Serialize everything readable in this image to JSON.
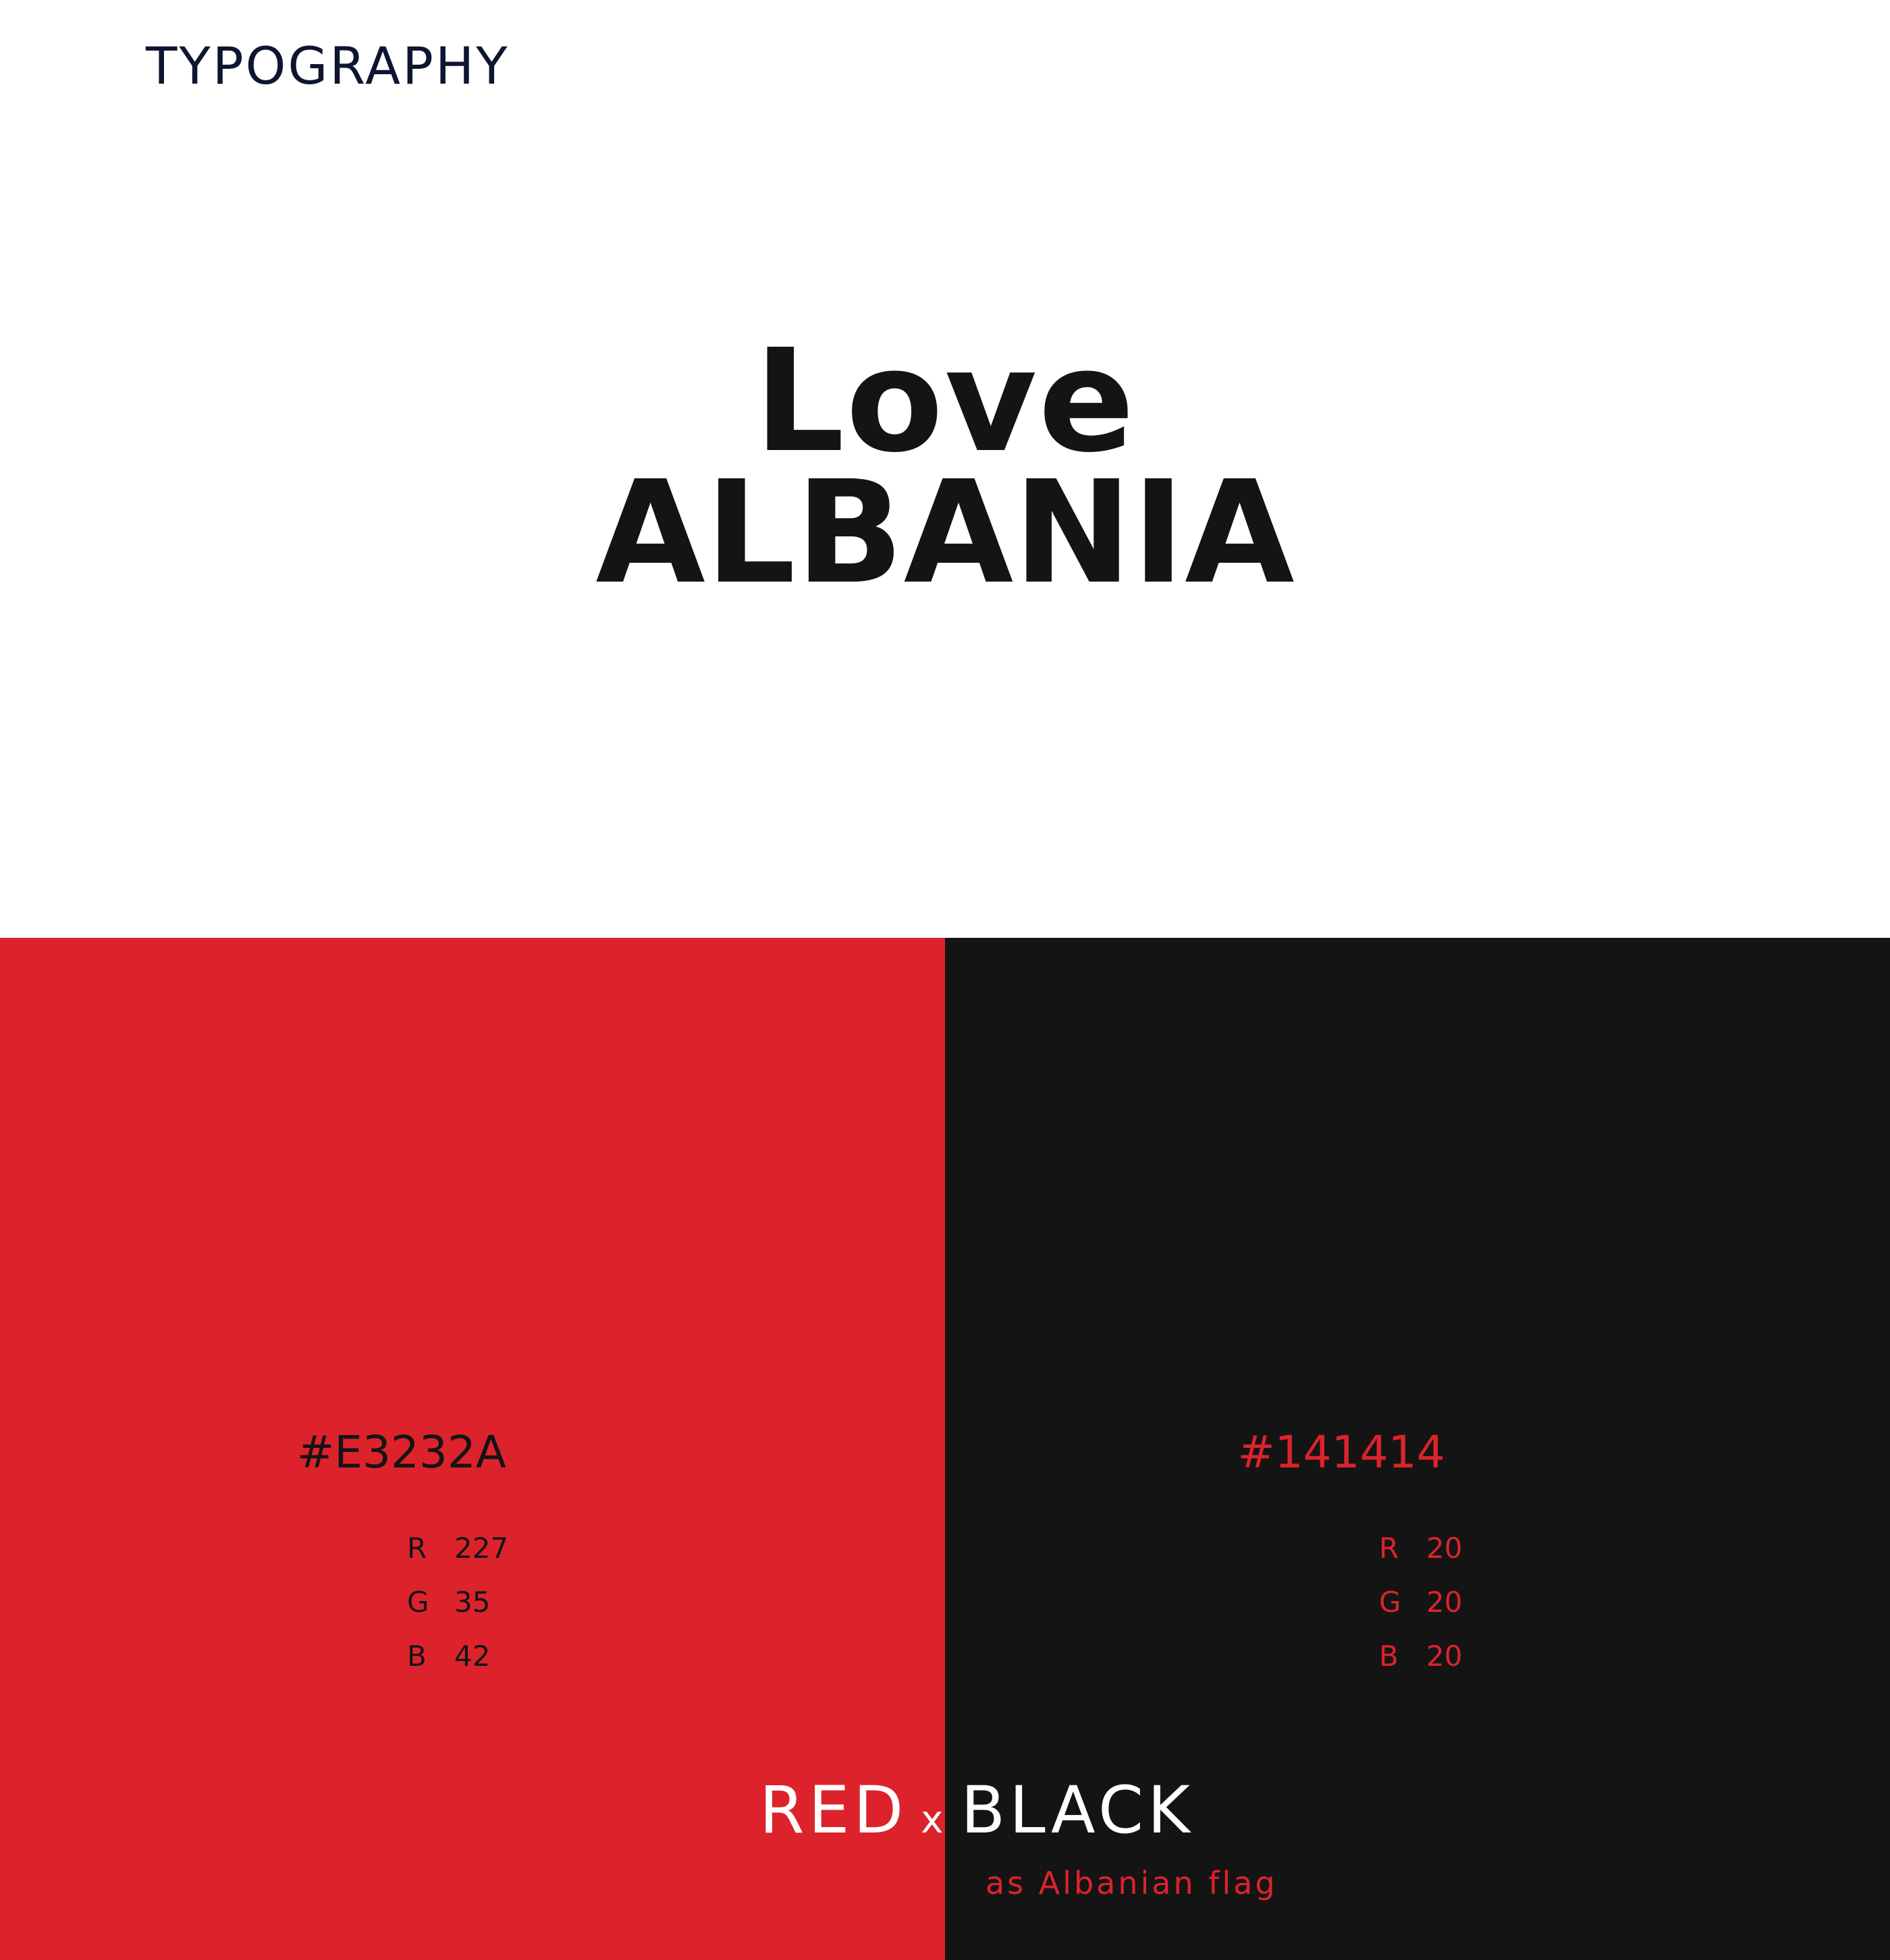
{
  "header": {
    "title": "TYPOGRAPHY"
  },
  "hero": {
    "line1": "Love",
    "line2": "ALBANIA"
  },
  "colors": {
    "text_dark": "#0e1530",
    "hero_text": "#141414",
    "white": "#ffffff"
  },
  "swatches": [
    {
      "hex": "#E3232A",
      "fill": "#dc232c",
      "text_color": "#141414",
      "rgb": [
        {
          "channel": "R",
          "value": "227"
        },
        {
          "channel": "G",
          "value": "35"
        },
        {
          "channel": "B",
          "value": "42"
        }
      ]
    },
    {
      "hex": "#141414",
      "fill": "#141414",
      "text_color": "#dc232c",
      "rgb": [
        {
          "channel": "R",
          "value": "20"
        },
        {
          "channel": "G",
          "value": "20"
        },
        {
          "channel": "B",
          "value": "20"
        }
      ]
    }
  ],
  "footer": {
    "left": "RED",
    "joiner": "x",
    "right": "BLACK",
    "subtitle": "as Albanian flag"
  }
}
